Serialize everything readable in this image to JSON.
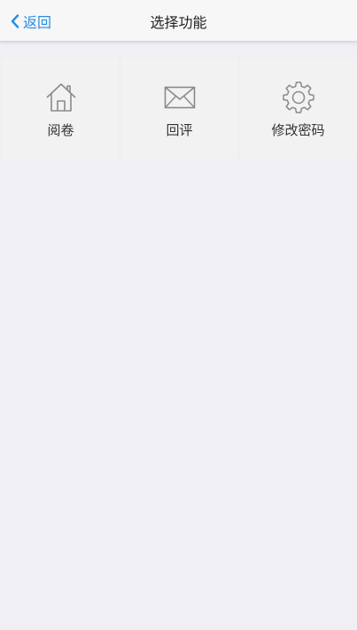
{
  "navbar": {
    "back_label": "返回",
    "title": "选择功能"
  },
  "menu": {
    "items": [
      {
        "label": "阅卷",
        "icon": "home-icon"
      },
      {
        "label": "回评",
        "icon": "mail-icon"
      },
      {
        "label": "修改密码",
        "icon": "gear-icon"
      }
    ]
  },
  "colors": {
    "accent": "#2a8ce6",
    "background": "#efeff4",
    "navbar": "#f7f7f7",
    "panel": "#f2f2f2",
    "icon": "#8a8a8a"
  }
}
